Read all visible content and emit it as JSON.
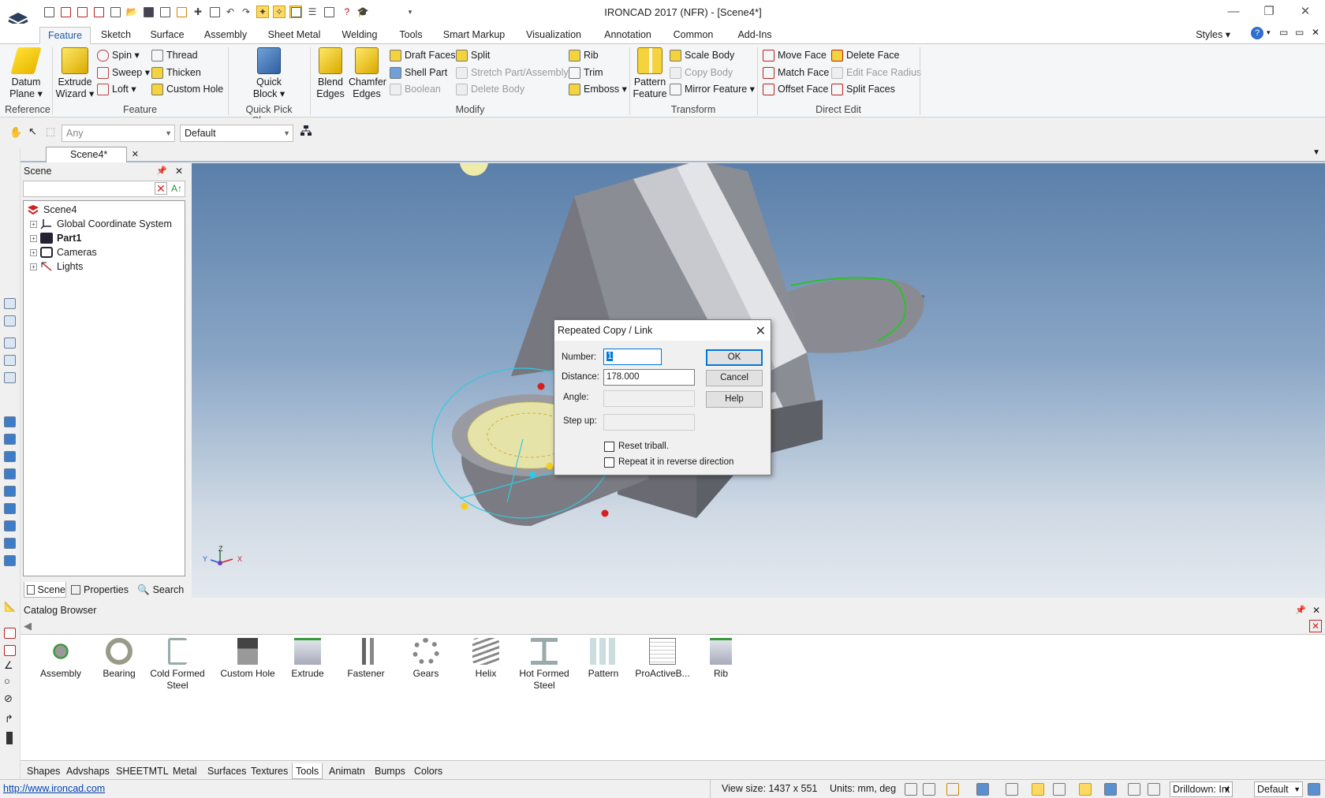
{
  "window": {
    "title": "IRONCAD 2017 (NFR) - [Scene4*]",
    "min": "—",
    "max": "❐",
    "close": "✕"
  },
  "ribbon_tabs": [
    "Feature",
    "Sketch",
    "Surface",
    "Assembly",
    "Sheet Metal",
    "Welding",
    "Tools",
    "Smart Markup",
    "Visualization",
    "Annotation",
    "Common",
    "Add-Ins"
  ],
  "styles_label": "Styles",
  "ribbon": {
    "reference": {
      "label": "Reference",
      "datum_plane": "Datum\nPlane ▾"
    },
    "feature": {
      "label": "Feature",
      "extrude_wizard": "Extrude\nWizard ▾",
      "spin": "Spin ▾",
      "sweep": "Sweep ▾",
      "loft": "Loft ▾",
      "thread": "Thread",
      "thicken": "Thicken",
      "custom_hole": "Custom Hole"
    },
    "quick_pick": {
      "label": "Quick Pick Shapes",
      "quick_block": "Quick\nBlock ▾"
    },
    "modify": {
      "label": "Modify",
      "blend_edges": "Blend\nEdges",
      "chamfer_edges": "Chamfer\nEdges",
      "draft_faces": "Draft Faces",
      "shell_part": "Shell Part",
      "boolean": "Boolean",
      "split": "Split",
      "stretch_part": "Stretch Part/Assembly",
      "delete_body": "Delete Body",
      "rib": "Rib",
      "trim": "Trim",
      "emboss": "Emboss ▾"
    },
    "transform": {
      "label": "Transform",
      "pattern_feature": "Pattern\nFeature",
      "scale_body": "Scale Body",
      "copy_body": "Copy Body",
      "mirror_feature": "Mirror Feature ▾"
    },
    "direct_edit": {
      "label": "Direct Edit",
      "move_face": "Move Face",
      "match_face": "Match Face",
      "offset_face": "Offset Face",
      "delete_face": "Delete Face",
      "edit_face_radius": "Edit Face Radius",
      "split_faces": "Split Faces"
    }
  },
  "toolbar": {
    "filter_value": "Any",
    "style_value": "Default"
  },
  "doc_tab": {
    "label": "Scene4*",
    "close": "✕"
  },
  "scene_panel": {
    "title": "Scene",
    "tree": [
      {
        "label": "Scene4",
        "bold": false
      },
      {
        "label": "Global Coordinate System",
        "bold": false
      },
      {
        "label": "Part1",
        "bold": true
      },
      {
        "label": "Cameras",
        "bold": false
      },
      {
        "label": "Lights",
        "bold": false
      }
    ],
    "tabs": [
      "Scene",
      "Properties",
      "Search"
    ]
  },
  "axis_labels": {
    "z": "Z",
    "x": "X",
    "y": "Y"
  },
  "dialog": {
    "title": "Repeated Copy / Link",
    "number_label": "Number:",
    "number_value": "1",
    "distance_label": "Distance:",
    "distance_value": "178.000",
    "angle_label": "Angle:",
    "stepup_label": "Step up:",
    "ok": "OK",
    "cancel": "Cancel",
    "help": "Help",
    "reset_triball": "Reset triball.",
    "repeat_reverse": "Repeat it in reverse direction"
  },
  "catalog": {
    "title": "Catalog Browser",
    "items": [
      "Assembly",
      "Bearing",
      "Cold Formed\nSteel",
      "Custom Hole",
      "Extrude",
      "Fastener",
      "Gears",
      "Helix",
      "Hot Formed\nSteel",
      "Pattern",
      "ProActiveB...",
      "Rib"
    ],
    "tabs": [
      "Shapes",
      "Advshaps",
      "SHEETMTL",
      "Metal",
      "Surfaces",
      "Textures",
      "Tools",
      "Animatn",
      "Bumps",
      "Colors"
    ],
    "active_tab": "Tools"
  },
  "status": {
    "link": "http://www.ironcad.com",
    "view_size": "View size: 1437 x  551",
    "units": "Units: mm, deg",
    "drilldown": "Drilldown: Int",
    "default": "Default"
  },
  "colors": {
    "accent": "#1f5aa8",
    "dialog_focus": "#0078d7",
    "selection_green": "#2ec02e"
  }
}
